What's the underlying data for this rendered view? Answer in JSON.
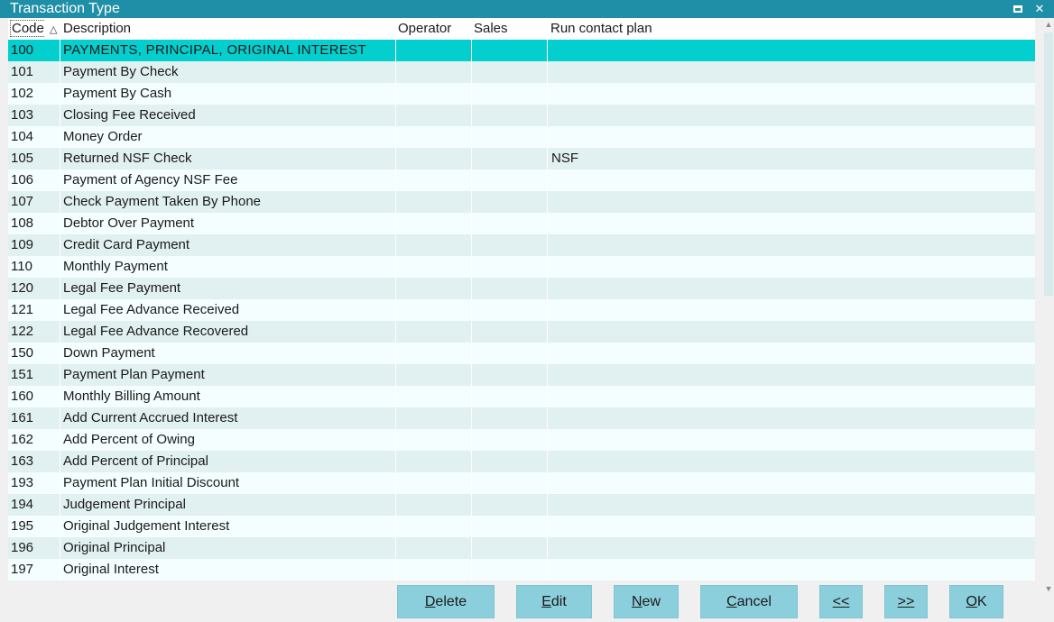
{
  "window": {
    "title": "Transaction Type",
    "maximize_icon": "window-maximize-icon",
    "close_icon": "close-icon",
    "close_glyph": "✕"
  },
  "table": {
    "columns": {
      "code": "Code",
      "description": "Description",
      "operator": "Operator",
      "sales": "Sales",
      "run_contact_plan": "Run contact plan"
    },
    "sort_indicator": "△",
    "selected_row": 0,
    "rows": [
      {
        "code": "100",
        "description": "PAYMENTS, PRINCIPAL, ORIGINAL INTEREST",
        "operator": "",
        "sales": "",
        "run_contact_plan": ""
      },
      {
        "code": "101",
        "description": "Payment By Check",
        "operator": "",
        "sales": "",
        "run_contact_plan": ""
      },
      {
        "code": "102",
        "description": "Payment By Cash",
        "operator": "",
        "sales": "",
        "run_contact_plan": ""
      },
      {
        "code": "103",
        "description": "Closing Fee Received",
        "operator": "",
        "sales": "",
        "run_contact_plan": ""
      },
      {
        "code": "104",
        "description": "Money Order",
        "operator": "",
        "sales": "",
        "run_contact_plan": ""
      },
      {
        "code": "105",
        "description": "Returned NSF Check",
        "operator": "",
        "sales": "",
        "run_contact_plan": "NSF"
      },
      {
        "code": "106",
        "description": "Payment of Agency NSF Fee",
        "operator": "",
        "sales": "",
        "run_contact_plan": ""
      },
      {
        "code": "107",
        "description": "Check Payment Taken By Phone",
        "operator": "",
        "sales": "",
        "run_contact_plan": ""
      },
      {
        "code": "108",
        "description": "Debtor Over Payment",
        "operator": "",
        "sales": "",
        "run_contact_plan": ""
      },
      {
        "code": "109",
        "description": "Credit Card Payment",
        "operator": "",
        "sales": "",
        "run_contact_plan": ""
      },
      {
        "code": "110",
        "description": "Monthly Payment",
        "operator": "",
        "sales": "",
        "run_contact_plan": ""
      },
      {
        "code": "120",
        "description": "Legal Fee Payment",
        "operator": "",
        "sales": "",
        "run_contact_plan": ""
      },
      {
        "code": "121",
        "description": "Legal Fee Advance Received",
        "operator": "",
        "sales": "",
        "run_contact_plan": ""
      },
      {
        "code": "122",
        "description": "Legal Fee Advance Recovered",
        "operator": "",
        "sales": "",
        "run_contact_plan": ""
      },
      {
        "code": "150",
        "description": "Down Payment",
        "operator": "",
        "sales": "",
        "run_contact_plan": ""
      },
      {
        "code": "151",
        "description": "Payment Plan Payment",
        "operator": "",
        "sales": "",
        "run_contact_plan": ""
      },
      {
        "code": "160",
        "description": "Monthly Billing Amount",
        "operator": "",
        "sales": "",
        "run_contact_plan": ""
      },
      {
        "code": "161",
        "description": "Add Current Accrued Interest",
        "operator": "",
        "sales": "",
        "run_contact_plan": ""
      },
      {
        "code": "162",
        "description": "Add Percent of Owing",
        "operator": "",
        "sales": "",
        "run_contact_plan": ""
      },
      {
        "code": "163",
        "description": "Add Percent of Principal",
        "operator": "",
        "sales": "",
        "run_contact_plan": ""
      },
      {
        "code": "193",
        "description": "Payment Plan Initial Discount",
        "operator": "",
        "sales": "",
        "run_contact_plan": ""
      },
      {
        "code": "194",
        "description": "Judgement Principal",
        "operator": "",
        "sales": "",
        "run_contact_plan": ""
      },
      {
        "code": "195",
        "description": "Original Judgement Interest",
        "operator": "",
        "sales": "",
        "run_contact_plan": ""
      },
      {
        "code": "196",
        "description": "Original Principal",
        "operator": "",
        "sales": "",
        "run_contact_plan": ""
      },
      {
        "code": "197",
        "description": "Original Interest",
        "operator": "",
        "sales": "",
        "run_contact_plan": ""
      }
    ]
  },
  "buttons": {
    "delete": {
      "mnemonic": "D",
      "rest": "elete"
    },
    "edit": {
      "mnemonic": "E",
      "rest": "dit"
    },
    "new": {
      "mnemonic": "N",
      "rest": "ew"
    },
    "cancel": {
      "mnemonic": "C",
      "rest": "ancel"
    },
    "prev": {
      "mnemonic": "<<",
      "rest": ""
    },
    "next": {
      "mnemonic": ">>",
      "rest": ""
    },
    "ok": {
      "mnemonic": "O",
      "rest": "K"
    }
  },
  "colors": {
    "titlebar": "#1f8fa8",
    "selected_row": "#04cfcf",
    "row_even": "#f4fefe",
    "row_odd": "#e1f0f0",
    "button": "#8ccfdc"
  }
}
